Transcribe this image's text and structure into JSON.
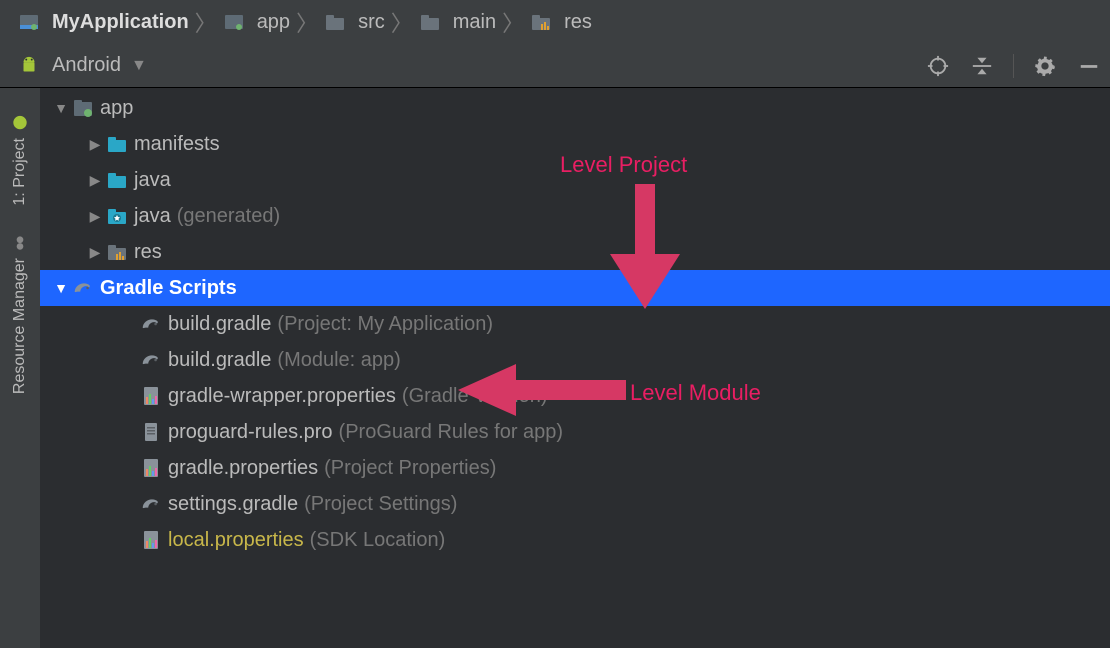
{
  "breadcrumb": [
    {
      "label": "MyApplication",
      "icon": "module"
    },
    {
      "label": "app",
      "icon": "module"
    },
    {
      "label": "src",
      "icon": "folder"
    },
    {
      "label": "main",
      "icon": "folder"
    },
    {
      "label": "res",
      "icon": "res-folder"
    }
  ],
  "toolbar": {
    "view_selector": "Android"
  },
  "sidebar": [
    {
      "label": "1: Project",
      "icon": "android"
    },
    {
      "label": "Resource Manager",
      "icon": "resource"
    }
  ],
  "tree": [
    {
      "indent": 1,
      "expand": "down",
      "icon": "module",
      "label": "app",
      "sub": "",
      "sel": false
    },
    {
      "indent": 2,
      "expand": "right",
      "icon": "folder",
      "label": "manifests",
      "sub": "",
      "sel": false
    },
    {
      "indent": 2,
      "expand": "right",
      "icon": "folder",
      "label": "java",
      "sub": "",
      "sel": false
    },
    {
      "indent": 2,
      "expand": "right",
      "icon": "gen",
      "label": "java",
      "sub": "(generated)",
      "sel": false
    },
    {
      "indent": 2,
      "expand": "right",
      "icon": "res-folder",
      "label": "res",
      "sub": "",
      "sel": false
    },
    {
      "indent": 1,
      "expand": "down",
      "icon": "gradle",
      "label": "Gradle Scripts",
      "sub": "",
      "sel": true
    },
    {
      "indent": 3,
      "expand": "",
      "icon": "gradle",
      "label": "build.gradle",
      "sub": "(Project: My Application)",
      "sel": false
    },
    {
      "indent": 3,
      "expand": "",
      "icon": "gradle",
      "label": "build.gradle",
      "sub": "(Module: app)",
      "sel": false
    },
    {
      "indent": 3,
      "expand": "",
      "icon": "props",
      "label": "gradle-wrapper.properties",
      "sub": "(Gradle Version)",
      "sel": false
    },
    {
      "indent": 3,
      "expand": "",
      "icon": "file",
      "label": "proguard-rules.pro",
      "sub": "(ProGuard Rules for app)",
      "sel": false
    },
    {
      "indent": 3,
      "expand": "",
      "icon": "props",
      "label": "gradle.properties",
      "sub": "(Project Properties)",
      "sel": false
    },
    {
      "indent": 3,
      "expand": "",
      "icon": "gradle",
      "label": "settings.gradle",
      "sub": "(Project Settings)",
      "sel": false
    },
    {
      "indent": 3,
      "expand": "",
      "icon": "props",
      "label": "local.properties",
      "sub": "(SDK Location)",
      "sel": false,
      "yellow": true
    }
  ],
  "annotations": {
    "project": "Level Project",
    "module": "Level Module"
  }
}
